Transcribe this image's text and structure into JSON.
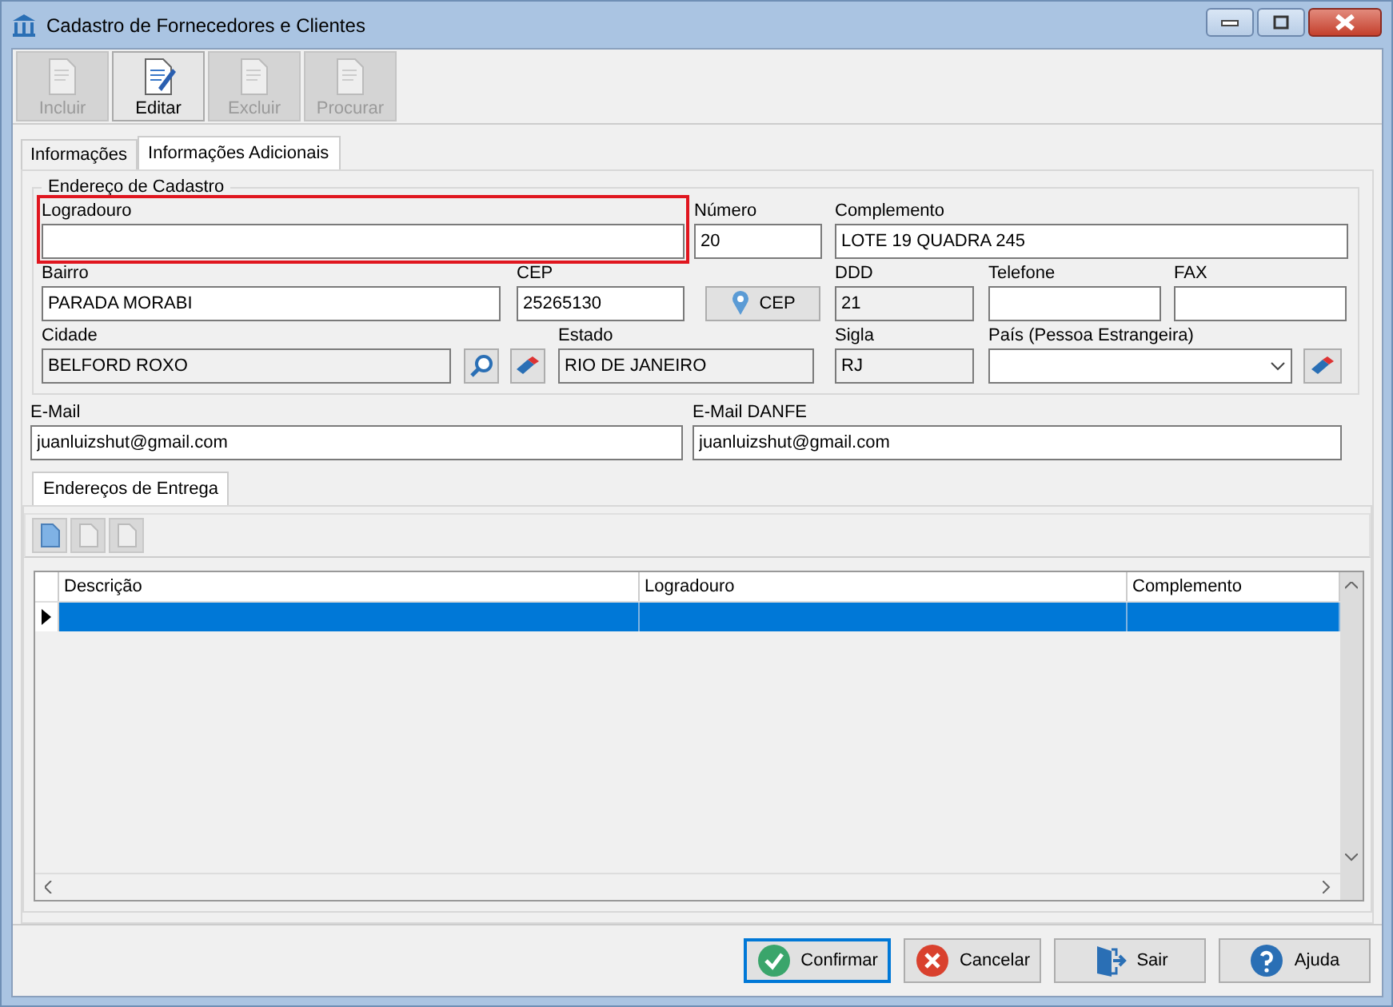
{
  "window": {
    "title": "Cadastro de Fornecedores e Clientes"
  },
  "toolbar": [
    {
      "label": "Incluir",
      "disabled": true
    },
    {
      "label": "Editar",
      "disabled": false
    },
    {
      "label": "Excluir",
      "disabled": true
    },
    {
      "label": "Procurar",
      "disabled": true
    }
  ],
  "tabs": [
    {
      "label": "Informações",
      "selected": false
    },
    {
      "label": "Informações Adicionais",
      "selected": true
    }
  ],
  "address_group": {
    "title": "Endereço de Cadastro",
    "fields": [
      {
        "kind": "text",
        "label": "Logradouro",
        "readonly": false,
        "highlighted": true
      },
      {
        "kind": "text",
        "label": "Número",
        "value": "20",
        "readonly": false
      },
      {
        "kind": "text",
        "label": "Complemento",
        "value": "LOTE 19 QUADRA 245",
        "readonly": false
      },
      {
        "kind": "text",
        "label": "Bairro",
        "value": "PARADA MORABI",
        "readonly": false
      },
      {
        "kind": "text",
        "label": "CEP",
        "value": "25265130",
        "readonly": false
      },
      {
        "kind": "locate",
        "label": "CEP"
      },
      {
        "kind": "text",
        "label": "DDD",
        "value": "21",
        "readonly": true
      },
      {
        "kind": "text",
        "label": "Telefone",
        "readonly": false
      },
      {
        "kind": "text",
        "label": "FAX",
        "readonly": false
      },
      {
        "kind": "text",
        "label": "Cidade",
        "value": "BELFORD ROXO",
        "readonly": true
      },
      {
        "kind": "lookup"
      },
      {
        "kind": "clear"
      },
      {
        "kind": "text",
        "label": "Estado",
        "value": "RIO DE JANEIRO",
        "readonly": true
      },
      {
        "kind": "text",
        "label": "Sigla",
        "value": "RJ",
        "readonly": true
      },
      {
        "kind": "combo",
        "label": "País (Pessoa Estrangeira)"
      },
      {
        "kind": "clear"
      }
    ]
  },
  "email_fields": [
    {
      "label": "E-Mail",
      "value": "juanluizshut@gmail.com",
      "readonly": false
    },
    {
      "label": "E-Mail DANFE",
      "value": "juanluizshut@gmail.com",
      "readonly": false
    }
  ],
  "delivery": {
    "tab": {
      "label": "Endereços de Entrega",
      "selected": true
    },
    "toolbar": [
      {
        "disabled": false
      },
      {
        "disabled": true
      },
      {
        "disabled": true
      }
    ],
    "table": {
      "columns": [
        "Descrição",
        "Logradouro",
        "Complemento"
      ],
      "rows": [
        {
          "selected": true
        }
      ]
    }
  },
  "buttons": [
    {
      "label": "Confirmar",
      "focused": true
    },
    {
      "label": "Cancelar",
      "focused": false
    },
    {
      "label": "Sair",
      "focused": false
    },
    {
      "label": "Ajuda",
      "focused": false
    }
  ]
}
